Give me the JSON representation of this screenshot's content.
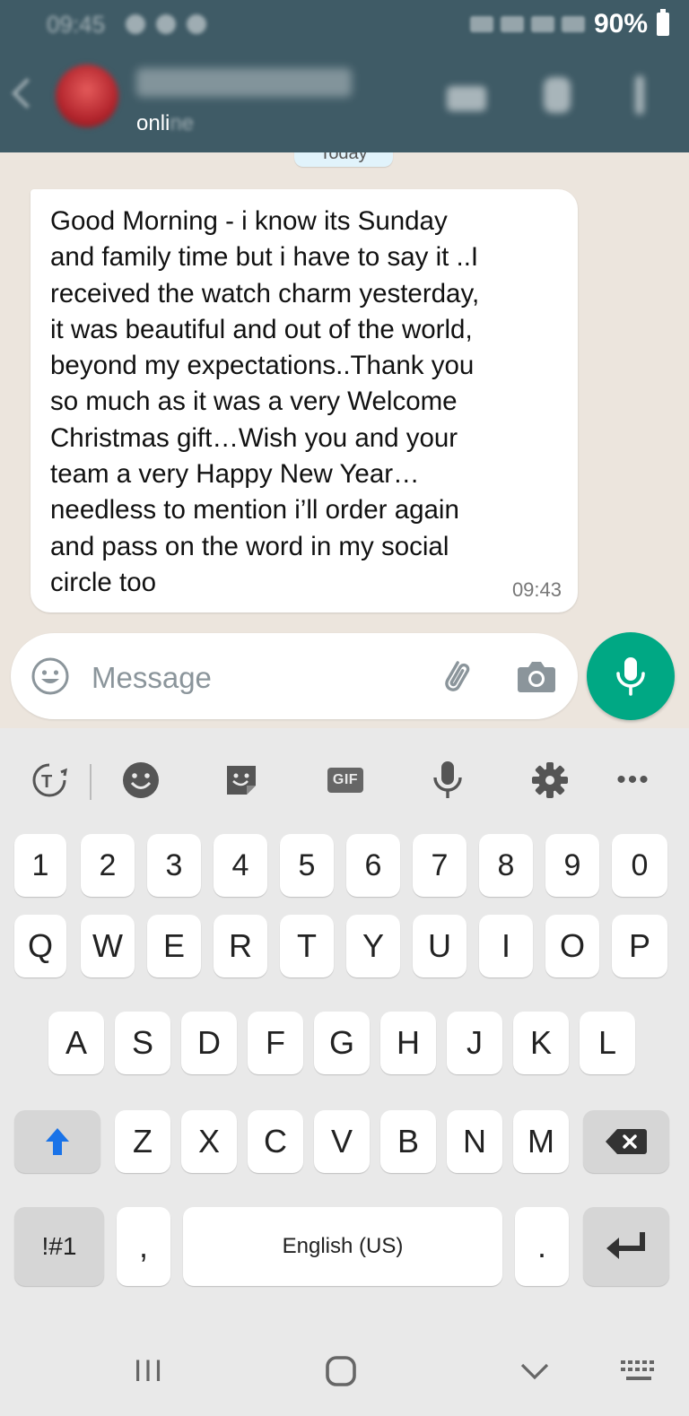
{
  "status_bar": {
    "time": "09:45",
    "battery": "90%",
    "icons": [
      "volte-icon",
      "wifi-icon",
      "signal-icon",
      "signal-icon",
      "battery-icon"
    ]
  },
  "chat_header": {
    "contact_status": "onli",
    "contact_status_blurred": "ne"
  },
  "conversation": {
    "date_chip": "Today",
    "messages": [
      {
        "direction": "incoming",
        "text": "Good Morning - i know its Sunday\nand family time but i have to say it ..I\nreceived the watch charm yesterday,\nit was beautiful and out of the world,\nbeyond my expectations..Thank you\nso much as it was a very Welcome\nChristmas gift…Wish you and your\nteam a very Happy New Year…\nneedless to mention i’ll order again\nand pass on the word in my social\ncircle too",
        "time": "09:43"
      }
    ]
  },
  "composer": {
    "placeholder": "Message"
  },
  "keyboard": {
    "toolbar_gif": "GIF",
    "toolbar_more": "•••",
    "number_row": [
      "1",
      "2",
      "3",
      "4",
      "5",
      "6",
      "7",
      "8",
      "9",
      "0"
    ],
    "row1": [
      "Q",
      "W",
      "E",
      "R",
      "T",
      "Y",
      "U",
      "I",
      "O",
      "P"
    ],
    "row2": [
      "A",
      "S",
      "D",
      "F",
      "G",
      "H",
      "J",
      "K",
      "L"
    ],
    "row3": [
      "Z",
      "X",
      "C",
      "V",
      "B",
      "N",
      "M"
    ],
    "symbols_key": "!#1",
    "comma_key": ",",
    "space_key": "English (US)",
    "period_key": ".",
    "nav_recents": "III"
  },
  "colors": {
    "header": "#3f5b66",
    "chat_bg": "#ece5dd",
    "accent_green": "#00a884",
    "shift_blue": "#1a73e8"
  }
}
